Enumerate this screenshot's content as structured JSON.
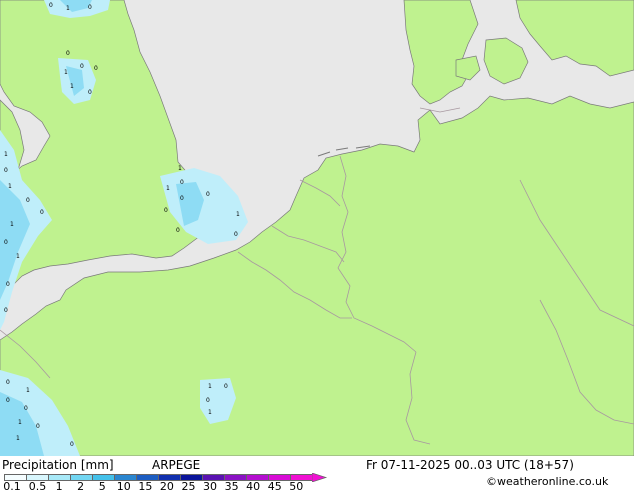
{
  "map": {
    "colors": {
      "sea": "#e8e8e8",
      "land": "#bff28f",
      "border": "#a898a0",
      "coast": "#7a7a7a",
      "precip_light": "#bfeefa",
      "precip_mid": "#8edcf4",
      "precip_strong": "#5cc9ee"
    },
    "rain_marks": [
      "0",
      "1",
      "0",
      "0",
      "1",
      "0",
      "0",
      "1",
      "0",
      "1",
      "0",
      "1",
      "0",
      "0",
      "1",
      "0",
      "1",
      "0",
      "0",
      "1",
      "0",
      "1",
      "0",
      "0",
      "0",
      "1",
      "0",
      "0",
      "1",
      "0",
      "0",
      "1",
      "0",
      "1",
      "0",
      "0",
      "1",
      "0",
      "1",
      "0"
    ]
  },
  "legend": {
    "title": "Precipitation [mm]",
    "model": "ARPEGE",
    "valid_time": "Fr 07-11-2025 00..03 UTC (18+57)",
    "credit": "©weatheronline.co.uk",
    "scale_labels": [
      "0.1",
      "0.5",
      "1",
      "2",
      "5",
      "10",
      "15",
      "20",
      "25",
      "30",
      "35",
      "40",
      "45",
      "50"
    ],
    "scale_colors": [
      "#f5fdff",
      "#d8f6fd",
      "#a8e9f8",
      "#72d6f2",
      "#44c1ea",
      "#2a86d0",
      "#1c5dc2",
      "#102fae",
      "#0a149a",
      "#5a12b2",
      "#8a12c4",
      "#b40ed0",
      "#d80cd6",
      "#f010d2"
    ]
  }
}
